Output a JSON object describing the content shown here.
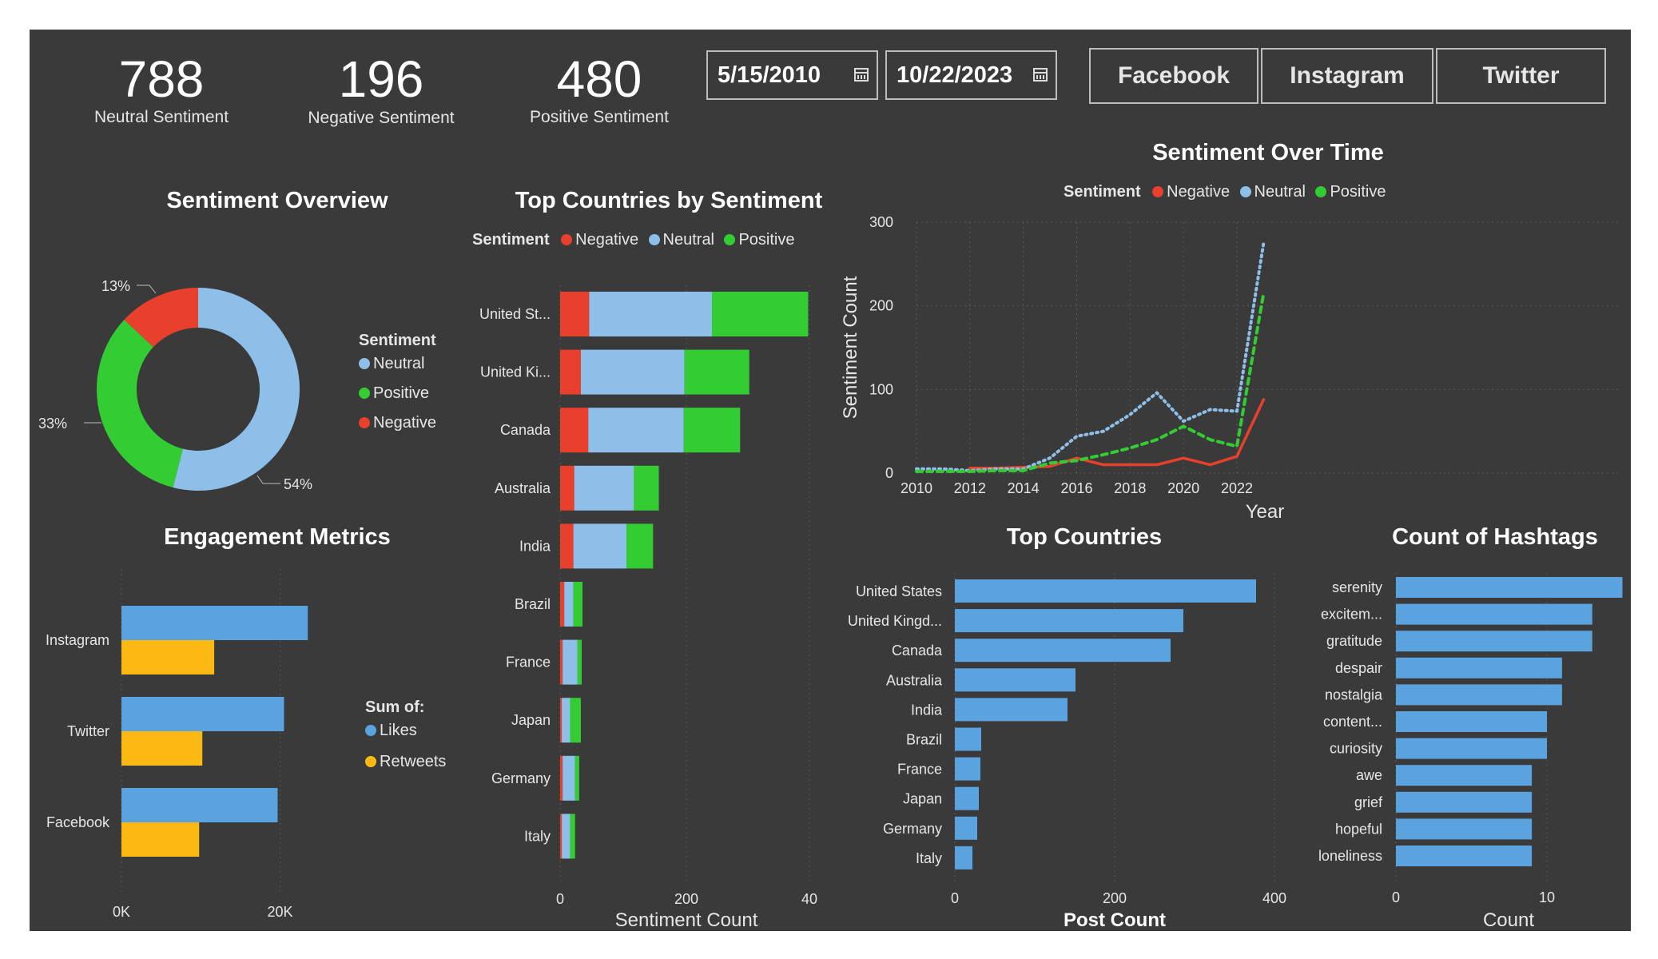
{
  "kpis": [
    {
      "value": "788",
      "label": "Neutral Sentiment"
    },
    {
      "value": "196",
      "label": "Negative Sentiment"
    },
    {
      "value": "480",
      "label": "Positive Sentiment"
    }
  ],
  "date_range": {
    "start": "5/15/2010",
    "end": "10/22/2023"
  },
  "platform_slicer": [
    "Facebook",
    "Instagram",
    "Twitter"
  ],
  "colors": {
    "negative": "#e8402c",
    "neutral": "#8ebfe8",
    "positive": "#33cc33",
    "bar_blue": "#5ba3df",
    "likes": "#5ba3df",
    "retweets": "#fdb913",
    "panel": "#3a3a3a"
  },
  "sentiment_overview": {
    "title": "Sentiment Overview",
    "legend_title": "Sentiment",
    "legend": [
      "Neutral",
      "Positive",
      "Negative"
    ],
    "labels": {
      "neutral": "54%",
      "positive": "33%",
      "negative": "13%"
    }
  },
  "engagement": {
    "title": "Engagement Metrics",
    "legend_title": "Sum of:",
    "legend": [
      "Likes",
      "Retweets"
    ],
    "x_ticks": [
      "0K",
      "20K"
    ]
  },
  "top_countries_sentiment": {
    "title": "Top Countries by Sentiment",
    "legend_title": "Sentiment",
    "legend": [
      "Negative",
      "Neutral",
      "Positive"
    ],
    "xlabel": "Sentiment Count",
    "x_ticks": [
      "0",
      "200",
      "40"
    ]
  },
  "sentiment_over_time": {
    "title": "Sentiment Over Time",
    "legend_title": "Sentiment",
    "legend": [
      "Negative",
      "Neutral",
      "Positive"
    ],
    "xlabel": "Year",
    "ylabel": "Sentiment Count",
    "x_ticks": [
      "2010",
      "2012",
      "2014",
      "2016",
      "2018",
      "2020",
      "2022"
    ],
    "y_ticks": [
      "0",
      "100",
      "200",
      "300"
    ]
  },
  "top_countries": {
    "title": "Top Countries",
    "xlabel": "Post Count",
    "x_ticks": [
      "0",
      "200",
      "400"
    ]
  },
  "hashtags": {
    "title": "Count of Hashtags",
    "xlabel": "Count",
    "x_ticks": [
      "0",
      "10"
    ]
  },
  "chart_data": [
    {
      "type": "pie",
      "title": "Sentiment Overview",
      "categories": [
        "Neutral",
        "Positive",
        "Negative"
      ],
      "values": [
        54,
        33,
        13
      ]
    },
    {
      "type": "bar",
      "title": "Engagement Metrics",
      "categories": [
        "Instagram",
        "Twitter",
        "Facebook"
      ],
      "series": [
        {
          "name": "Likes",
          "values": [
            23500,
            20500,
            19700
          ]
        },
        {
          "name": "Retweets",
          "values": [
            11700,
            10200,
            9800
          ]
        }
      ],
      "xlim": [
        0,
        26000
      ]
    },
    {
      "type": "bar",
      "title": "Top Countries by Sentiment",
      "categories": [
        "United St...",
        "United Ki...",
        "Canada",
        "Australia",
        "India",
        "Brazil",
        "France",
        "Japan",
        "Germany",
        "Italy"
      ],
      "series": [
        {
          "name": "Negative",
          "values": [
            35,
            25,
            34,
            17,
            16,
            5,
            3,
            2,
            3,
            2
          ]
        },
        {
          "name": "Neutral",
          "values": [
            148,
            125,
            115,
            72,
            64,
            11,
            18,
            10,
            15,
            10
          ]
        },
        {
          "name": "Positive",
          "values": [
            116,
            78,
            68,
            30,
            32,
            11,
            5,
            13,
            5,
            6
          ]
        }
      ],
      "xlabel": "Sentiment Count",
      "xlim": [
        0,
        314
      ]
    },
    {
      "type": "line",
      "title": "Sentiment Over Time",
      "x": [
        2010,
        2011,
        2012,
        2013,
        2014,
        2015,
        2016,
        2017,
        2018,
        2019,
        2020,
        2021,
        2022,
        2023
      ],
      "series": [
        {
          "name": "Negative",
          "values": [
            null,
            null,
            6,
            6,
            7,
            8,
            18,
            10,
            10,
            10,
            18,
            10,
            20,
            88
          ]
        },
        {
          "name": "Neutral",
          "values": [
            5,
            5,
            3,
            5,
            5,
            18,
            44,
            50,
            70,
            96,
            62,
            76,
            74,
            275
          ]
        },
        {
          "name": "Positive",
          "values": [
            2,
            2,
            2,
            3,
            3,
            12,
            15,
            22,
            30,
            40,
            56,
            40,
            32,
            215
          ]
        }
      ],
      "xlabel": "Year",
      "ylabel": "Sentiment Count",
      "ylim": [
        0,
        300
      ]
    },
    {
      "type": "bar",
      "title": "Top Countries",
      "categories": [
        "United States",
        "United Kingd...",
        "Canada",
        "Australia",
        "India",
        "Brazil",
        "France",
        "Japan",
        "Germany",
        "Italy"
      ],
      "values": [
        377,
        286,
        270,
        151,
        141,
        33,
        32,
        30,
        28,
        22
      ],
      "xlabel": "Post Count",
      "xlim": [
        0,
        400
      ]
    },
    {
      "type": "bar",
      "title": "Count of Hashtags",
      "categories": [
        "serenity",
        "excitem...",
        "gratitude",
        "despair",
        "nostalgia",
        "content...",
        "curiosity",
        "awe",
        "grief",
        "hopeful",
        "loneliness"
      ],
      "values": [
        15,
        13,
        13,
        11,
        11,
        10,
        10,
        9,
        9,
        9,
        9
      ],
      "xlabel": "Count",
      "xlim": [
        0,
        10
      ]
    }
  ]
}
